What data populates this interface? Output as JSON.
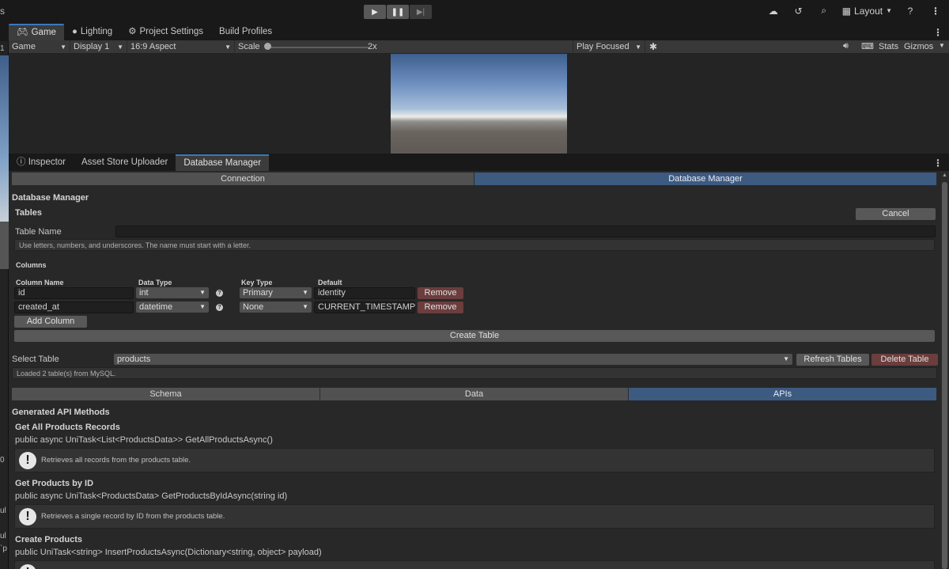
{
  "toolbar": {
    "left_fragment": "s",
    "play_icons": [
      "play-icon",
      "pause-icon",
      "step-icon"
    ],
    "right_icons": [
      "cloud-icon",
      "history-icon",
      "search-icon"
    ],
    "layout_label": "Layout",
    "help_icon": "help-icon"
  },
  "left_strip": {
    "fragments": [
      "1",
      "0",
      "ul",
      "ul",
      "`p"
    ]
  },
  "game_tabs": [
    {
      "label": "Game",
      "icon": "gamepad-icon"
    },
    {
      "label": "Lighting",
      "icon": "bulb-icon"
    },
    {
      "label": "Project Settings",
      "icon": "gear-icon"
    },
    {
      "label": "Build Profiles",
      "icon": ""
    }
  ],
  "game_toolbar": {
    "view": "Game",
    "display": "Display 1",
    "aspect": "16:9 Aspect",
    "scale_label": "Scale",
    "scale_value": "2x",
    "play_mode": "Play Focused",
    "stats": "Stats",
    "gizmos": "Gizmos"
  },
  "inspector_tabs": [
    {
      "label": "Inspector",
      "icon": "info-icon"
    },
    {
      "label": "Asset Store Uploader",
      "icon": ""
    },
    {
      "label": "Database Manager",
      "icon": ""
    }
  ],
  "db": {
    "mode_tabs": [
      "Connection",
      "Database Manager"
    ],
    "section_title": "Database Manager",
    "tables_title": "Tables",
    "cancel": "Cancel",
    "table_name_label": "Table Name",
    "table_name_value": "",
    "table_name_hint": "Use letters, numbers, and underscores. The name must start with a letter.",
    "columns_title": "Columns",
    "col_headers": {
      "name": "Column Name",
      "type": "Data Type",
      "key": "Key Type",
      "default": "Default"
    },
    "columns": [
      {
        "name": "id",
        "type": "int",
        "key": "Primary",
        "default": "identity",
        "remove": "Remove"
      },
      {
        "name": "created_at",
        "type": "datetime",
        "key": "None",
        "default": "CURRENT_TIMESTAMP",
        "remove": "Remove"
      }
    ],
    "add_column": "Add Column",
    "create_table": "Create Table",
    "select_table_label": "Select Table",
    "select_table_value": "products",
    "refresh_tables": "Refresh Tables",
    "delete_table": "Delete Table",
    "status": "Loaded 2 table(s) from MySQL.",
    "view_tabs": [
      "Schema",
      "Data",
      "APIs"
    ],
    "api_title": "Generated API Methods",
    "apis": [
      {
        "title": "Get All Products Records",
        "signature": "public async UniTask<List<ProductsData>> GetAllProductsAsync()",
        "desc": "Retrieves all records from the products table."
      },
      {
        "title": "Get Products by ID",
        "signature": "public async UniTask<ProductsData> GetProductsByIdAsync(string id)",
        "desc": "Retrieves a single record by ID from the products table."
      },
      {
        "title": "Create Products",
        "signature": "public UniTask<string> InsertProductsAsync(Dictionary<string, object> payload)",
        "desc": ""
      }
    ]
  }
}
